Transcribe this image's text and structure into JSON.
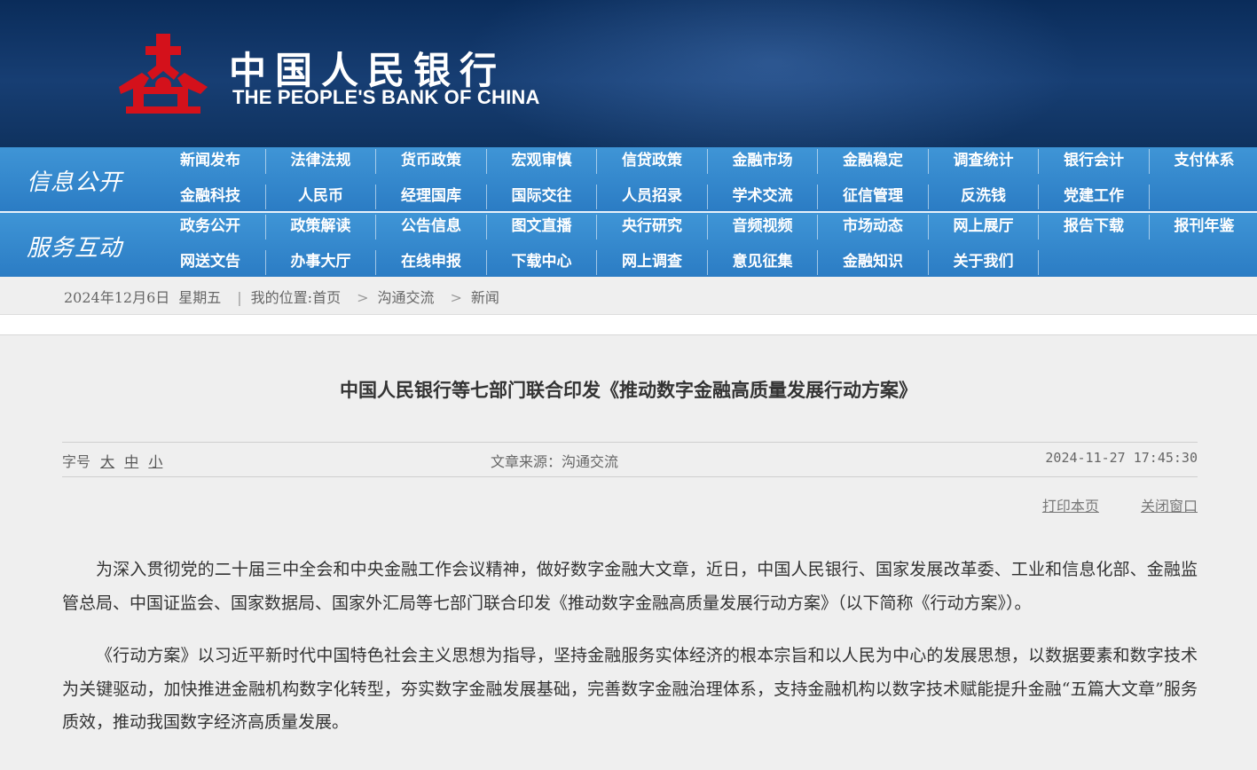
{
  "header": {
    "logo_cn": "中国人民银行",
    "logo_en": "THE PEOPLE'S BANK OF CHINA"
  },
  "nav": {
    "info_title": "信息公开",
    "info_row1": [
      "新闻发布",
      "法律法规",
      "货币政策",
      "宏观审慎",
      "信贷政策",
      "金融市场",
      "金融稳定",
      "调查统计",
      "银行会计",
      "支付体系"
    ],
    "info_row2": [
      "金融科技",
      "人民币",
      "经理国库",
      "国际交往",
      "人员招录",
      "学术交流",
      "征信管理",
      "反洗钱",
      "党建工作"
    ],
    "service_title": "服务互动",
    "service_row1": [
      "政务公开",
      "政策解读",
      "公告信息",
      "图文直播",
      "央行研究",
      "音频视频",
      "市场动态",
      "网上展厅",
      "报告下载",
      "报刊年鉴"
    ],
    "service_row2": [
      "网送文告",
      "办事大厅",
      "在线申报",
      "下载中心",
      "网上调查",
      "意见征集",
      "金融知识",
      "关于我们"
    ]
  },
  "breadcrumb": {
    "date": "2024年12月6日",
    "weekday": "星期五",
    "location_label": "我的位置:首页",
    "level1": "沟通交流",
    "level2": "新闻"
  },
  "article": {
    "title": "中国人民银行等七部门联合印发《推动数字金融高质量发展行动方案》",
    "font_label": "字号",
    "font_large": "大",
    "font_medium": "中",
    "font_small": "小",
    "source": "文章来源：沟通交流",
    "datetime": "2024-11-27 17:45:30",
    "print_label": "打印本页",
    "close_label": "关闭窗口",
    "paragraphs": [
      "为深入贯彻党的二十届三中全会和中央金融工作会议精神，做好数字金融大文章，近日，中国人民银行、国家发展改革委、工业和信息化部、金融监管总局、中国证监会、国家数据局、国家外汇局等七部门联合印发《推动数字金融高质量发展行动方案》（以下简称《行动方案》）。",
      "《行动方案》以习近平新时代中国特色社会主义思想为指导，坚持金融服务实体经济的根本宗旨和以人民为中心的发展思想，以数据要素和数字技术为关键驱动，加快推进金融机构数字化转型，夯实数字金融发展基础，完善数字金融治理体系，支持金融机构以数字技术赋能提升金融“五篇大文章”服务质效，推动我国数字经济高质量发展。"
    ]
  }
}
